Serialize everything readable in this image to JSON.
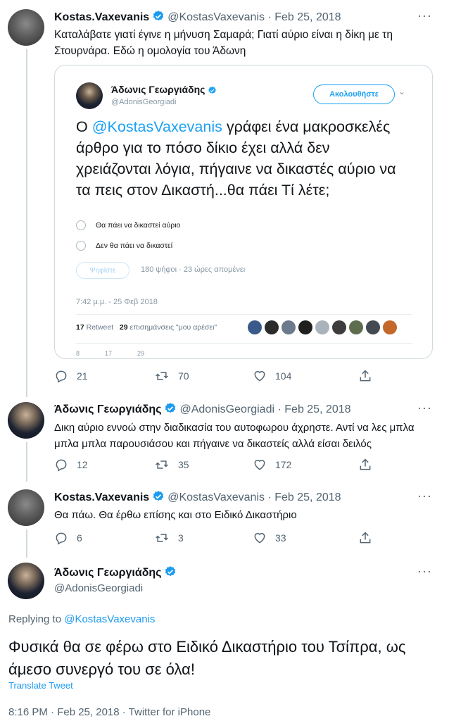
{
  "tweets": [
    {
      "name": "Kostas.Vaxevanis",
      "handle": "@KostasVaxevanis",
      "date": "Feb 25, 2018",
      "text": "Καταλάβατε γιατί έγινε η μήνυση Σαμαρά; Γιατί αύριο είναι η δίκη με τη Στουρνάρα. Εδώ η ομολογία του Άδωνη",
      "replies": "21",
      "retweets": "70",
      "likes": "104"
    },
    {
      "name": "Άδωνις Γεωργιάδης",
      "handle": "@AdonisGeorgiadi",
      "date": "Feb 25, 2018",
      "text": "Δικη αύριο εννοώ στην διαδικασία του αυτοφωρου άχρηστε. Αντί να λες μπλα μπλα μπλα παρουσιάσου και πήγαινε να δικαστείς αλλά είσαι δειλός",
      "replies": "12",
      "retweets": "35",
      "likes": "172"
    },
    {
      "name": "Kostas.Vaxevanis",
      "handle": "@KostasVaxevanis",
      "date": "Feb 25, 2018",
      "text": "Θα πάω. Θα έρθω επίσης και στο Ειδικό Δικαστήριο",
      "replies": "6",
      "retweets": "3",
      "likes": "33"
    }
  ],
  "separator": "·",
  "more_label": "···",
  "embed": {
    "name": "Άδωνις Γεωργιάδης",
    "handle": "@AdonisGeorgiadi",
    "follow_label": "Ακολουθήστε",
    "chevron": "⌄",
    "body_prefix": "Ο ",
    "body_mention": "@KostasVaxevanis",
    "body_rest": " γράφει ένα μακροσκελές άρθρο για το πόσο δίκιο έχει αλλά δεν χρειάζονται λόγια, πήγαινε να δικαστές αύριο να τα πεις στον Δικαστή...θα πάει Τί λέτε;",
    "poll_options": [
      "Θα πάει να δικαστεί αύριο",
      "Δεν θα πάει να δικαστεί"
    ],
    "vote_label": "Ψηφίστε",
    "votes_info": "180 ψήφοι · 23 ώρες απομένει",
    "timestamp": "7:42 μ.μ. - 25 Φεβ 2018",
    "retweets_count": "17",
    "retweets_label": "Retweet",
    "likes_count": "29",
    "likes_label": "επισημάνσεις \"μου αρέσει\"",
    "bottom_counts": [
      "8",
      "17",
      "29"
    ]
  },
  "focused": {
    "name": "Άδωνις Γεωργιάδης",
    "handle": "@AdonisGeorgiadi",
    "replying_prefix": "Replying to",
    "replying_handle": "@KostasVaxevanis",
    "text": "Φυσικά θα σε φέρω στο Ειδικό Δικαστήριο του Τσίπρα, ως άμεσο συνεργό του σε όλα!",
    "translate_label": "Translate Tweet",
    "meta": "8:16 PM · Feb 25, 2018 · Twitter for iPhone"
  },
  "colors": {
    "accent": "#1d9bf0",
    "secondary_text": "#536471",
    "thread_line": "#cfd9de"
  }
}
